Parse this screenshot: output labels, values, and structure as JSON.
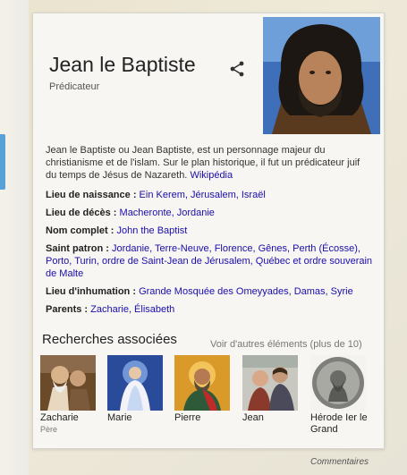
{
  "entity": {
    "name": "Jean le Baptiste",
    "type": "Prédicateur",
    "description": "Jean le Baptiste ou Jean Baptiste, est un personnage majeur du christianisme et de l'islam. Sur le plan historique, il fut un prédicateur juif du temps de Jésus de Nazareth. ",
    "source": "Wikipédia"
  },
  "facts": [
    {
      "label": "Lieu de naissance : ",
      "value": "Ein Kerem, Jérusalem, Israël"
    },
    {
      "label": "Lieu de décès : ",
      "value": "Macheronte, Jordanie"
    },
    {
      "label": "Nom complet : ",
      "value": "John the Baptist"
    },
    {
      "label": "Saint patron : ",
      "value": "Jordanie, Terre-Neuve, Florence, Gênes, Perth (Écosse), Porto, Turin, ordre de Saint-Jean de Jérusalem, Québec et ordre souverain de Malte"
    },
    {
      "label": "Lieu d'inhumation : ",
      "value": "Grande Mosquée des Omeyyades, Damas, Syrie"
    },
    {
      "label": "Parents : ",
      "value": "Zacharie, Élisabeth"
    }
  ],
  "related": {
    "heading": "Recherches associées",
    "more_link": "Voir d'autres éléments (plus de 10)",
    "items": [
      {
        "name": "Zacharie",
        "role": "Père"
      },
      {
        "name": "Marie",
        "role": ""
      },
      {
        "name": "Pierre",
        "role": ""
      },
      {
        "name": "Jean",
        "role": ""
      },
      {
        "name": "Hérode Ier le Grand",
        "role": ""
      }
    ]
  },
  "footer": {
    "feedback": "Commentaires"
  },
  "icons": {
    "share": "share-icon"
  },
  "colors": {
    "link": "#1a0dab",
    "left_bar": "#5aa0d8"
  }
}
